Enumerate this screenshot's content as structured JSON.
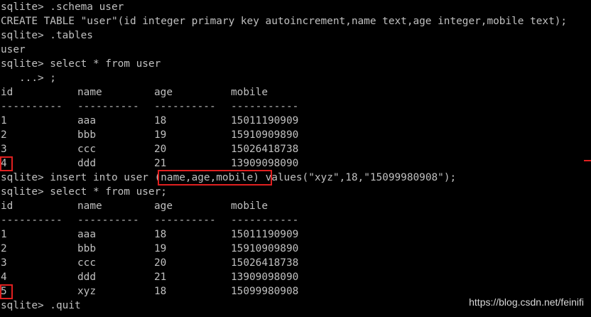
{
  "terminal": {
    "prompt": "sqlite>",
    "continuation_prompt": "   ...>",
    "lines_before_table1": [
      "sqlite> .schema user",
      "CREATE TABLE \"user\"(id integer primary key autoincrement,name text,age integer,mobile text);",
      "sqlite> .tables",
      "user",
      "sqlite> select * from user",
      "   ...> ;"
    ],
    "table1": {
      "headers": [
        "id",
        "name",
        "age",
        "mobile"
      ],
      "separators": [
        "----------",
        "----------",
        "----------",
        "-----------"
      ],
      "rows": [
        [
          "1",
          "aaa",
          "18",
          "15011190909"
        ],
        [
          "2",
          "bbb",
          "19",
          "15910909890"
        ],
        [
          "3",
          "ccc",
          "20",
          "15026418738"
        ],
        [
          "4",
          "ddd",
          "21",
          "13909098090"
        ]
      ]
    },
    "insert_command": {
      "before": "sqlite> insert into user ",
      "highlight": "(name,age,mobile)",
      "after": " values(\"xyz\",18,\"15099980908\");"
    },
    "select_again": "sqlite> select * from user;",
    "table2": {
      "headers": [
        "id",
        "name",
        "age",
        "mobile"
      ],
      "separators": [
        "----------",
        "----------",
        "----------",
        "-----------"
      ],
      "rows": [
        [
          "1",
          "aaa",
          "18",
          "15011190909"
        ],
        [
          "2",
          "bbb",
          "19",
          "15910909890"
        ],
        [
          "3",
          "ccc",
          "20",
          "15026418738"
        ],
        [
          "4",
          "ddd",
          "21",
          "13909098090"
        ],
        [
          "5",
          "xyz",
          "18",
          "15099980908"
        ]
      ]
    },
    "quit_command": "sqlite> .quit"
  },
  "watermark": "https://blog.csdn.net/feinifi",
  "colors": {
    "background": "#000000",
    "text": "#c0c0c0",
    "highlight_border": "#e02020"
  }
}
